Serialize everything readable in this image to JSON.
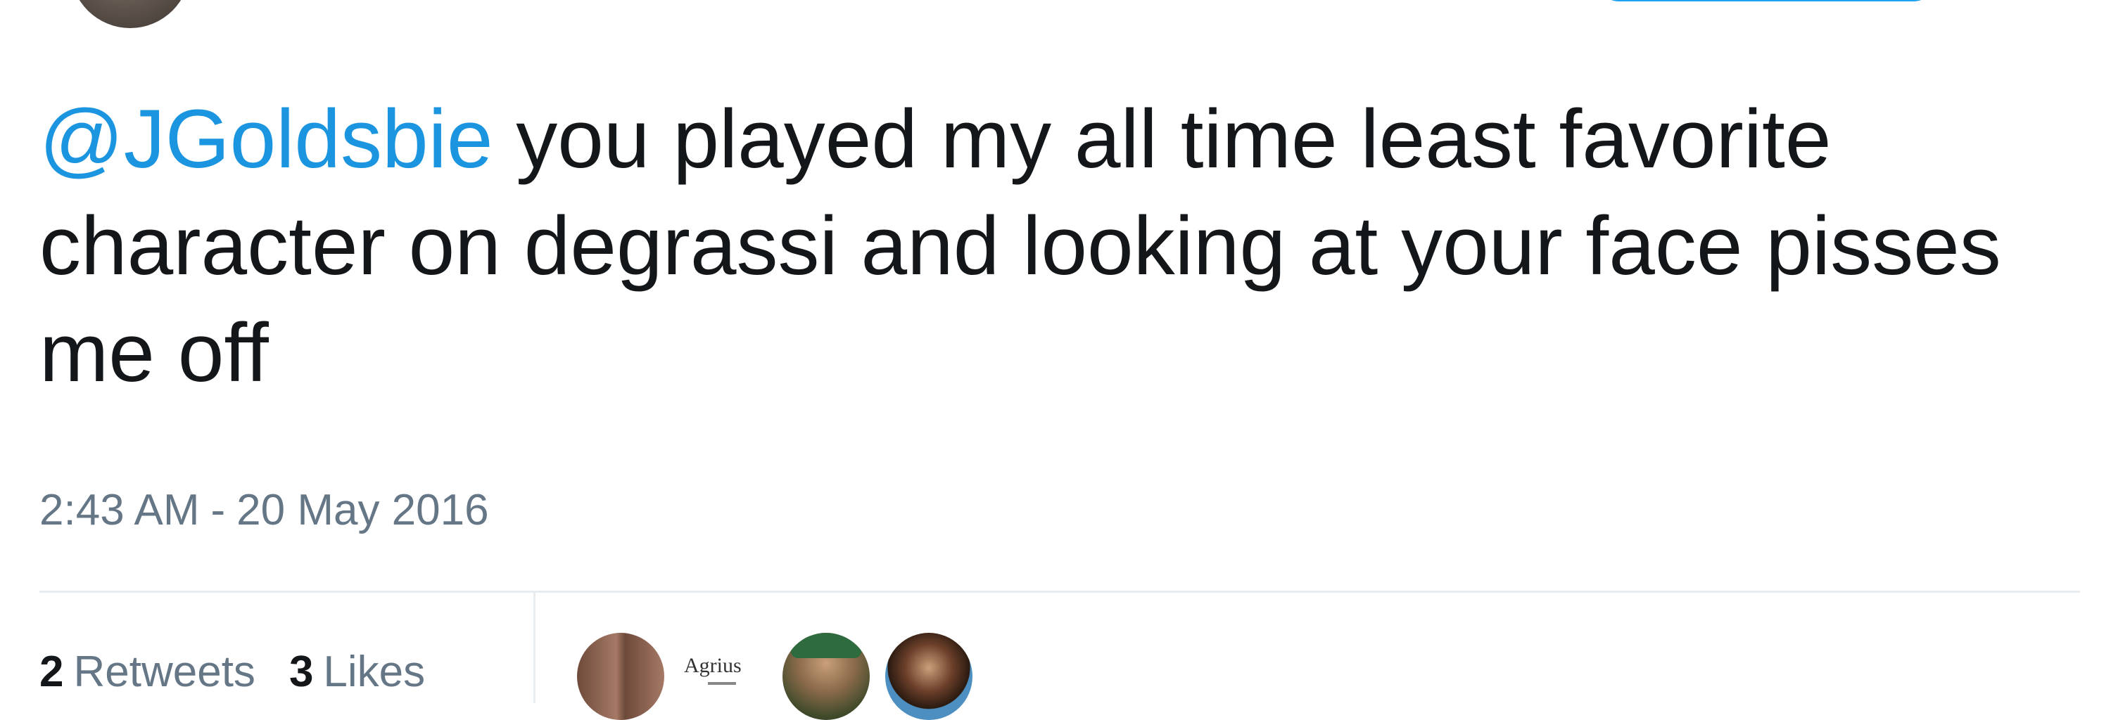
{
  "tweet": {
    "mention": "@JGoldsbie",
    "text": " you played my all time least favorite character on degrassi and looking at your face pisses me off",
    "time": "2:43 AM",
    "separator": "-",
    "date": "20 May 2016"
  },
  "stats": {
    "retweets_count": "2",
    "retweets_label": "Retweets",
    "likes_count": "3",
    "likes_label": "Likes"
  },
  "likers": [
    {
      "name": "liker-avatar-1"
    },
    {
      "name": "liker-avatar-2",
      "text": "Agrius"
    },
    {
      "name": "liker-avatar-3"
    },
    {
      "name": "liker-avatar-4"
    }
  ],
  "colors": {
    "mention": "#1b95e0",
    "text": "#14171a",
    "muted": "#657786",
    "divider": "#e6ecf0",
    "follow_border": "#1da1f2"
  }
}
